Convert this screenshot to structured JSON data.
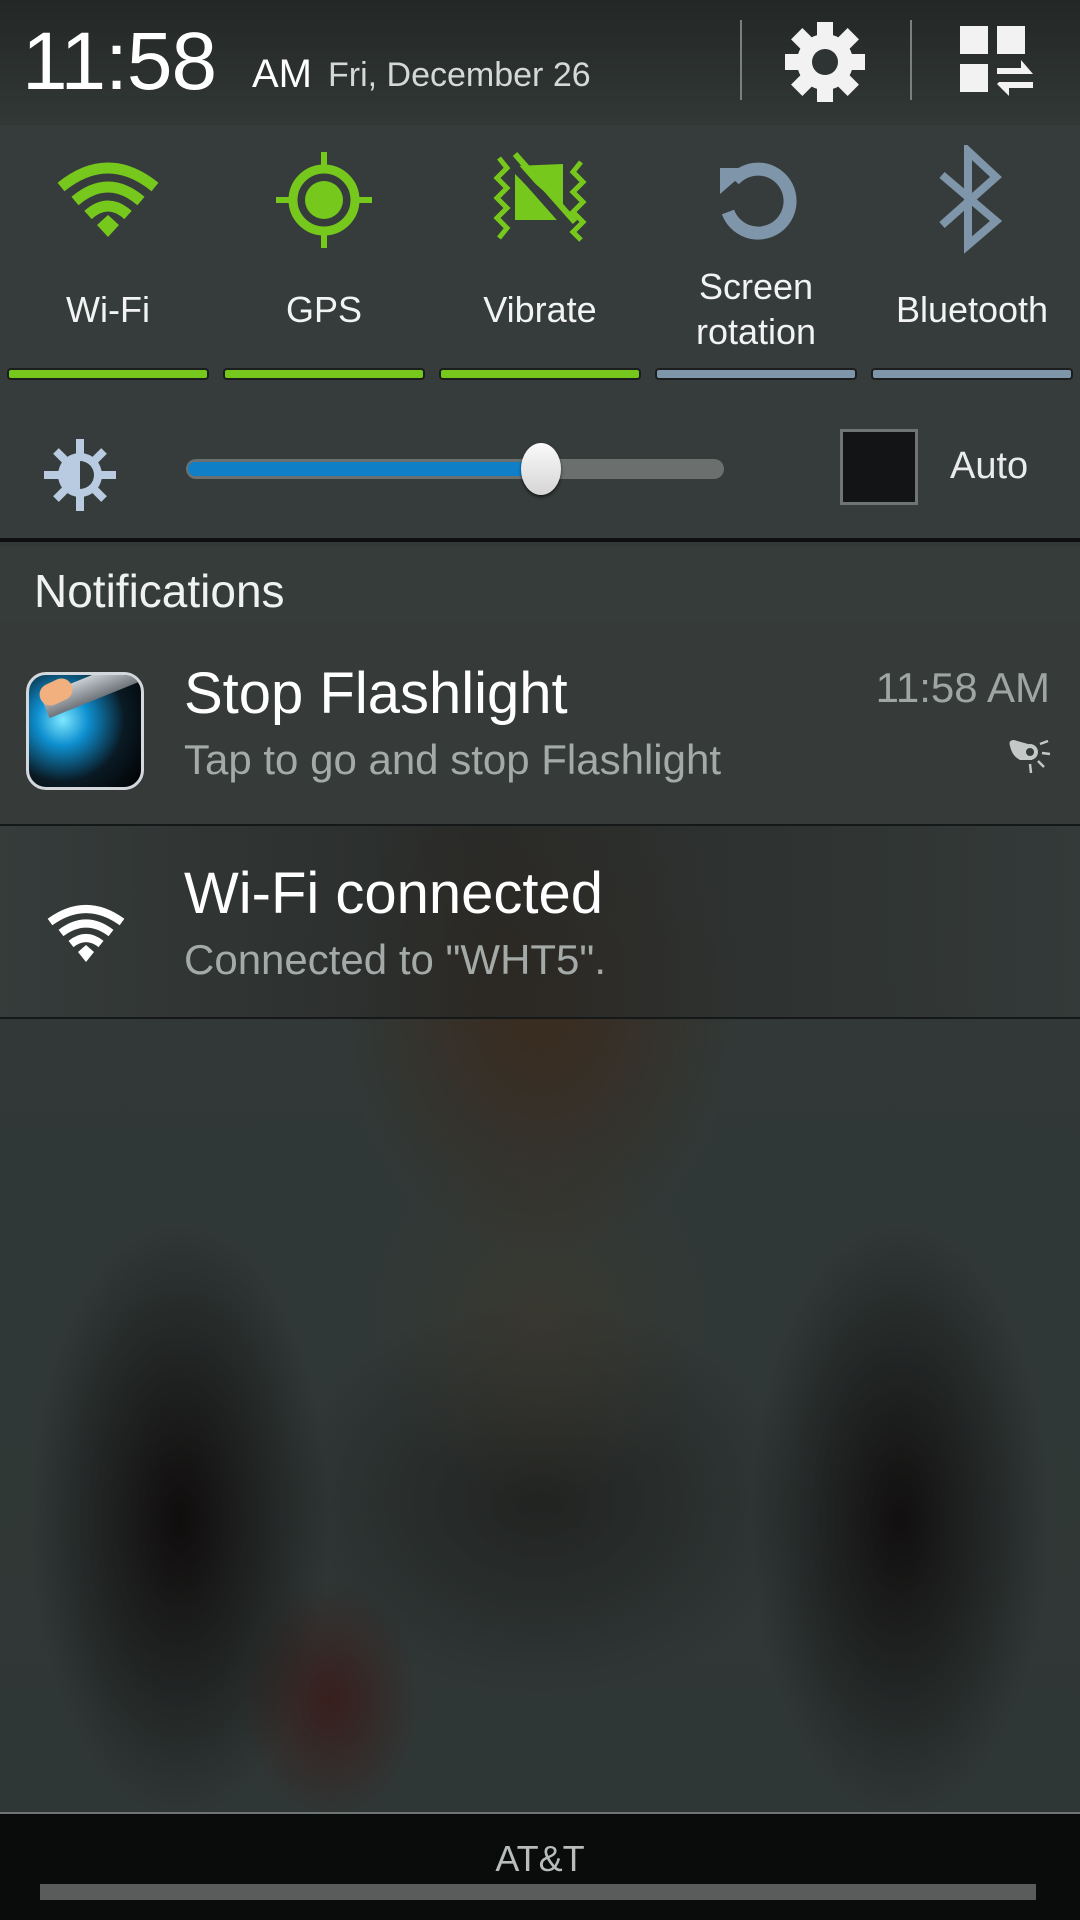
{
  "header": {
    "time": "11:58",
    "ampm": "AM",
    "date": "Fri, December 26",
    "settings_icon": "gear-icon",
    "multiwindow_icon": "multi-window-icon"
  },
  "quick_settings": [
    {
      "label": "Wi-Fi",
      "icon": "wifi-icon",
      "state": "on"
    },
    {
      "label": "GPS",
      "icon": "gps-icon",
      "state": "on"
    },
    {
      "label": "Vibrate",
      "icon": "vibrate-icon",
      "state": "on"
    },
    {
      "label_line1": "Screen",
      "label_line2": "rotation",
      "icon": "screen-rotation-icon",
      "state": "off"
    },
    {
      "label": "Bluetooth",
      "icon": "bluetooth-icon",
      "state": "off"
    }
  ],
  "brightness": {
    "icon": "brightness-icon",
    "level_percent": 66,
    "auto_label": "Auto",
    "auto_checked": false
  },
  "notifications": {
    "section_title": "Notifications",
    "items": [
      {
        "title": "Stop Flashlight",
        "text": "Tap to go and stop Flashlight",
        "time": "11:58 AM",
        "icon": "flashlight-app-icon",
        "small_icon": "flashlight-icon"
      },
      {
        "title": "Wi-Fi connected",
        "text": "Connected to \"WHT5\".",
        "icon": "wifi-icon"
      }
    ]
  },
  "carrier": {
    "label": "AT&T"
  },
  "colors": {
    "active": "#77c81d",
    "inactive": "#7f95a9",
    "slider": "#0f80c8"
  }
}
